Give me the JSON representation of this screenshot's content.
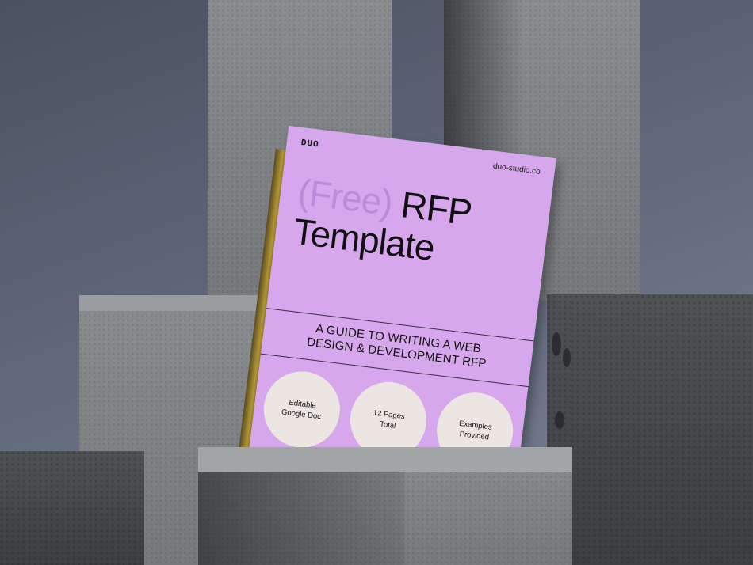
{
  "book": {
    "logo": "DUO",
    "website": "duo-studio.co",
    "title_prefix": "(Free)",
    "title_main": "RFP",
    "title_line2": "Template",
    "subtitle_line1": "A GUIDE TO WRITING A WEB",
    "subtitle_line2": "DESIGN & DEVELOPMENT RFP",
    "features": [
      {
        "line1": "Editable",
        "line2": "Google Doc"
      },
      {
        "line1": "12 Pages",
        "line2": "Total"
      },
      {
        "line1": "Examples",
        "line2": "Provided"
      }
    ]
  },
  "colors": {
    "cover": "#d6a7ec",
    "free_text": "#bd8cd8",
    "circle_fill": "#ece6e2",
    "backdrop": "#5a6374",
    "concrete": "#7e8183"
  }
}
